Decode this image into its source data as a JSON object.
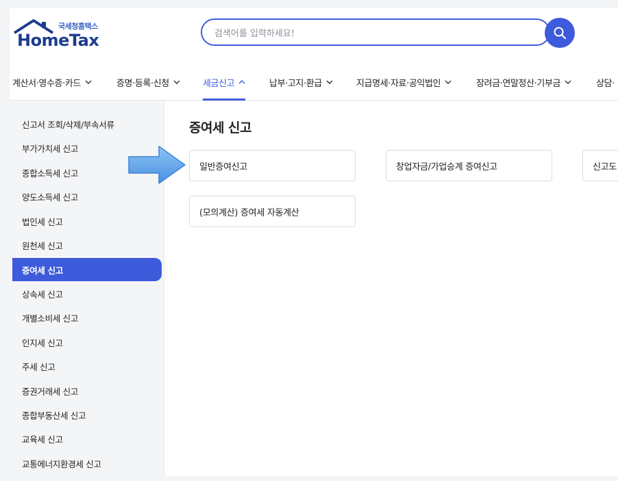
{
  "logo": {
    "subtitle": "국세청홈택스",
    "title": "HomeTax"
  },
  "search": {
    "placeholder": "검색어를 입력하세요!",
    "value": ""
  },
  "topnav": {
    "items": [
      {
        "label": "계산서·영수증·카드",
        "state": "collapsed"
      },
      {
        "label": "증명·등록·신청",
        "state": "collapsed"
      },
      {
        "label": "세금신고",
        "state": "expanded"
      },
      {
        "label": "납부·고지·환급",
        "state": "collapsed"
      },
      {
        "label": "지급명세·자료·공익법인",
        "state": "collapsed"
      },
      {
        "label": "장려금·연말정산·기부금",
        "state": "collapsed"
      },
      {
        "label": "상담·"
      }
    ]
  },
  "sidebar": {
    "items": [
      {
        "label": "신고서 조회/삭제/부속서류"
      },
      {
        "label": "부가가치세 신고"
      },
      {
        "label": "종합소득세 신고"
      },
      {
        "label": "양도소득세 신고"
      },
      {
        "label": "법인세 신고"
      },
      {
        "label": "원천세 신고"
      },
      {
        "label": "증여세 신고",
        "active": true
      },
      {
        "label": "상속세 신고"
      },
      {
        "label": "개별소비세 신고"
      },
      {
        "label": "인지세 신고"
      },
      {
        "label": "주세 신고"
      },
      {
        "label": "증권거래세 신고"
      },
      {
        "label": "종합부동산세 신고"
      },
      {
        "label": "교육세 신고"
      },
      {
        "label": "교통에너지환경세 신고"
      }
    ]
  },
  "main": {
    "title": "증여세 신고",
    "cards": [
      {
        "label": "일반증여신고"
      },
      {
        "label": "창업자금/가업승계 증여신고"
      },
      {
        "label": "신고도"
      },
      {
        "label": "(모의계산) 증여세 자동계산"
      }
    ]
  },
  "colors": {
    "accent": "#3e5bdb",
    "arrow": "#5aa0e6",
    "sidebar_bg": "#f4f5f7"
  },
  "icons": {
    "logo": "house-roof-icon",
    "search": "search-icon",
    "chevron": "chevron-down-icon",
    "chevron_active": "chevron-up-icon",
    "annotation": "right-arrow-annotation"
  }
}
